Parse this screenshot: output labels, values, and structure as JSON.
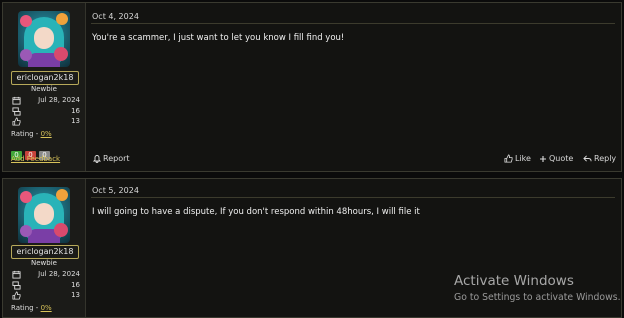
{
  "posts": [
    {
      "author": {
        "username": "ericlogan2k18",
        "role": "Newbie",
        "joined": "Jul 28, 2024",
        "messages": "16",
        "reactions": "13"
      },
      "rating_label": "Rating -",
      "rating_value": "0%",
      "feedback_counts": {
        "positive": "0",
        "negative": "0",
        "neutral": "0"
      },
      "add_feedback": "Add Feedback",
      "date": "Oct 4, 2024",
      "message": "You're a scammer, I just want to let you know I fill find you!",
      "actions": {
        "report": "Report",
        "like": "Like",
        "quote": "Quote",
        "reply": "Reply"
      }
    },
    {
      "author": {
        "username": "ericlogan2k18",
        "role": "Newbie",
        "joined": "Jul 28, 2024",
        "messages": "16",
        "reactions": "13"
      },
      "rating_label": "Rating -",
      "rating_value": "0%",
      "date": "Oct 5, 2024",
      "message": "I will going to have a dispute, If you don't respond within 48hours, I will file it"
    }
  ],
  "watermark": {
    "line1": "Activate Windows",
    "line2": "Go to Settings to activate Windows."
  },
  "colors": {
    "accent": "#d8c35a",
    "positive": "#42a63a",
    "negative": "#c8433b",
    "neutral": "#8a8a8a"
  }
}
